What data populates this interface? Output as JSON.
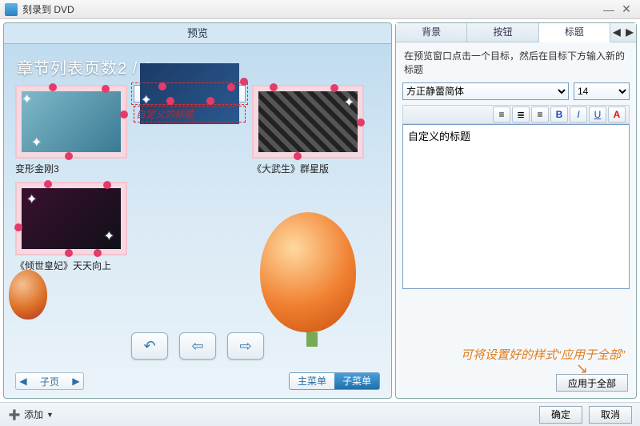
{
  "window": {
    "title": "刻录到 DVD"
  },
  "preview": {
    "header": "预览",
    "page_title_prefix": "章节列表页数",
    "page_index": "2 / 2",
    "thumbs": [
      {
        "caption": "变形金刚3",
        "editing": false
      },
      {
        "caption": "自定义的标题",
        "editing": true
      },
      {
        "caption": "《大武生》群星版",
        "editing": false
      },
      {
        "caption": "《倾世皇妃》天天向上",
        "editing": false
      }
    ],
    "pager_label": "子页",
    "seg_main": "主菜单",
    "seg_sub": "子菜单"
  },
  "side": {
    "tabs": {
      "bg": "背景",
      "btn": "按钮",
      "title": "标题"
    },
    "hint": "在预览窗口点击一个目标，然后在目标下方输入新的标题",
    "font_name": "方正静蕾简体",
    "font_size": "14",
    "text_value": "自定义的标题",
    "annotation": "可将设置好的样式“应用于全部”",
    "apply_all": "应用于全部"
  },
  "footer": {
    "add": "添加",
    "ok": "确定",
    "cancel": "取消"
  }
}
